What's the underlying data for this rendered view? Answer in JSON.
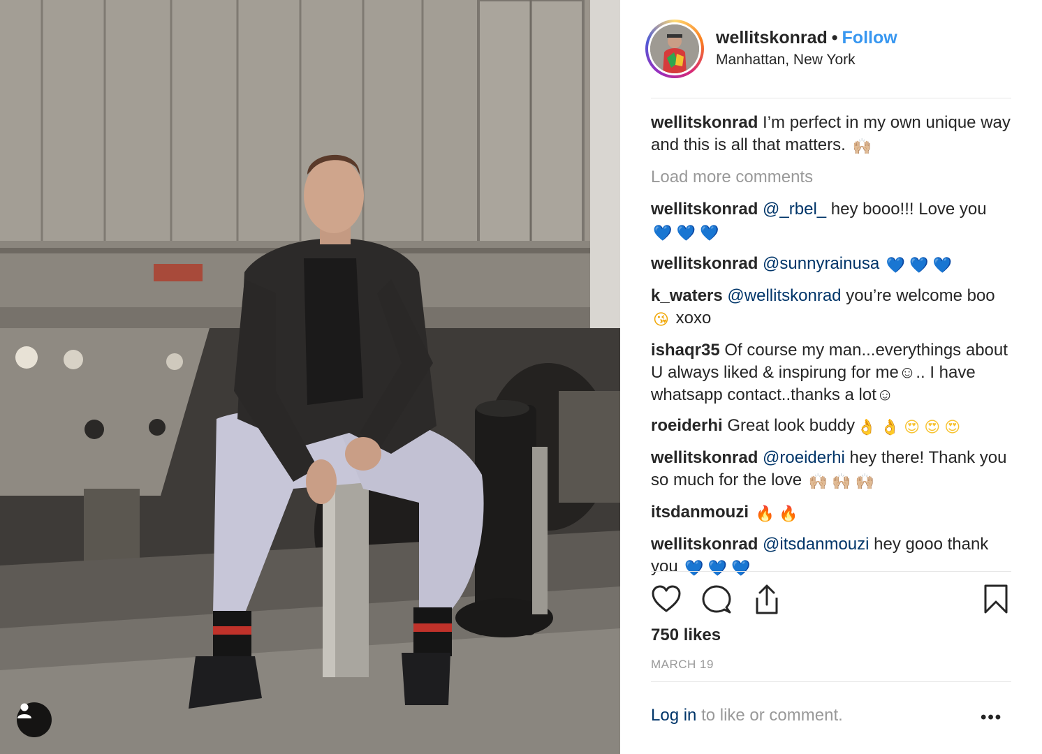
{
  "post": {
    "username": "wellitskonrad",
    "separator": "•",
    "follow_label": "Follow",
    "location": "Manhattan, New York"
  },
  "caption": {
    "username": "wellitskonrad",
    "text": "I’m perfect in my own unique way and this is all that matters.",
    "emoji": "🙌🏼"
  },
  "load_more_label": "Load more comments",
  "comments": [
    {
      "user": "wellitskonrad",
      "mention": "@_rbel_",
      "text": "hey booo!!! Love you",
      "emoji": "💙 💙 💙"
    },
    {
      "user": "wellitskonrad",
      "mention": "@sunnyrainusa",
      "text": "",
      "emoji": "💙 💙 💙"
    },
    {
      "user": "k_waters",
      "mention": "@wellitskonrad",
      "text": "you’re welcome boo",
      "emoji": "😘",
      "text2": "xoxo"
    },
    {
      "user": "ishaqr35",
      "mention": "",
      "text": "Of course my man...everythings about U always liked & inspirung for me☺.. I have whatsapp contact..thanks a lot☺",
      "emoji": ""
    },
    {
      "user": "roeiderhi",
      "mention": "",
      "text": "Great look buddy",
      "emoji": "👌 👌 😍 😍 😍"
    },
    {
      "user": "wellitskonrad",
      "mention": "@roeiderhi",
      "text": "hey there! Thank you so much for the love",
      "emoji": "🙌🏼 🙌🏼 🙌🏼"
    },
    {
      "user": "itsdanmouzi",
      "mention": "",
      "text": "",
      "emoji": "🔥 🔥"
    },
    {
      "user": "wellitskonrad",
      "mention": "@itsdanmouzi",
      "text": "hey gooo thank you",
      "emoji": "💙 💙 💙"
    }
  ],
  "likes": "750 likes",
  "date": "MARCH 19",
  "login": {
    "link": "Log in",
    "rest": "to like or comment."
  },
  "more_label": "•••",
  "icons": {
    "like": "heart-outline-icon",
    "comment": "comment-bubble-icon",
    "share": "share-upload-icon",
    "save": "bookmark-icon",
    "user_tags": "user-silhouette-icon"
  },
  "colors": {
    "follow": "#3897f0",
    "mention": "#003569",
    "muted": "#999999",
    "text": "#262626"
  }
}
